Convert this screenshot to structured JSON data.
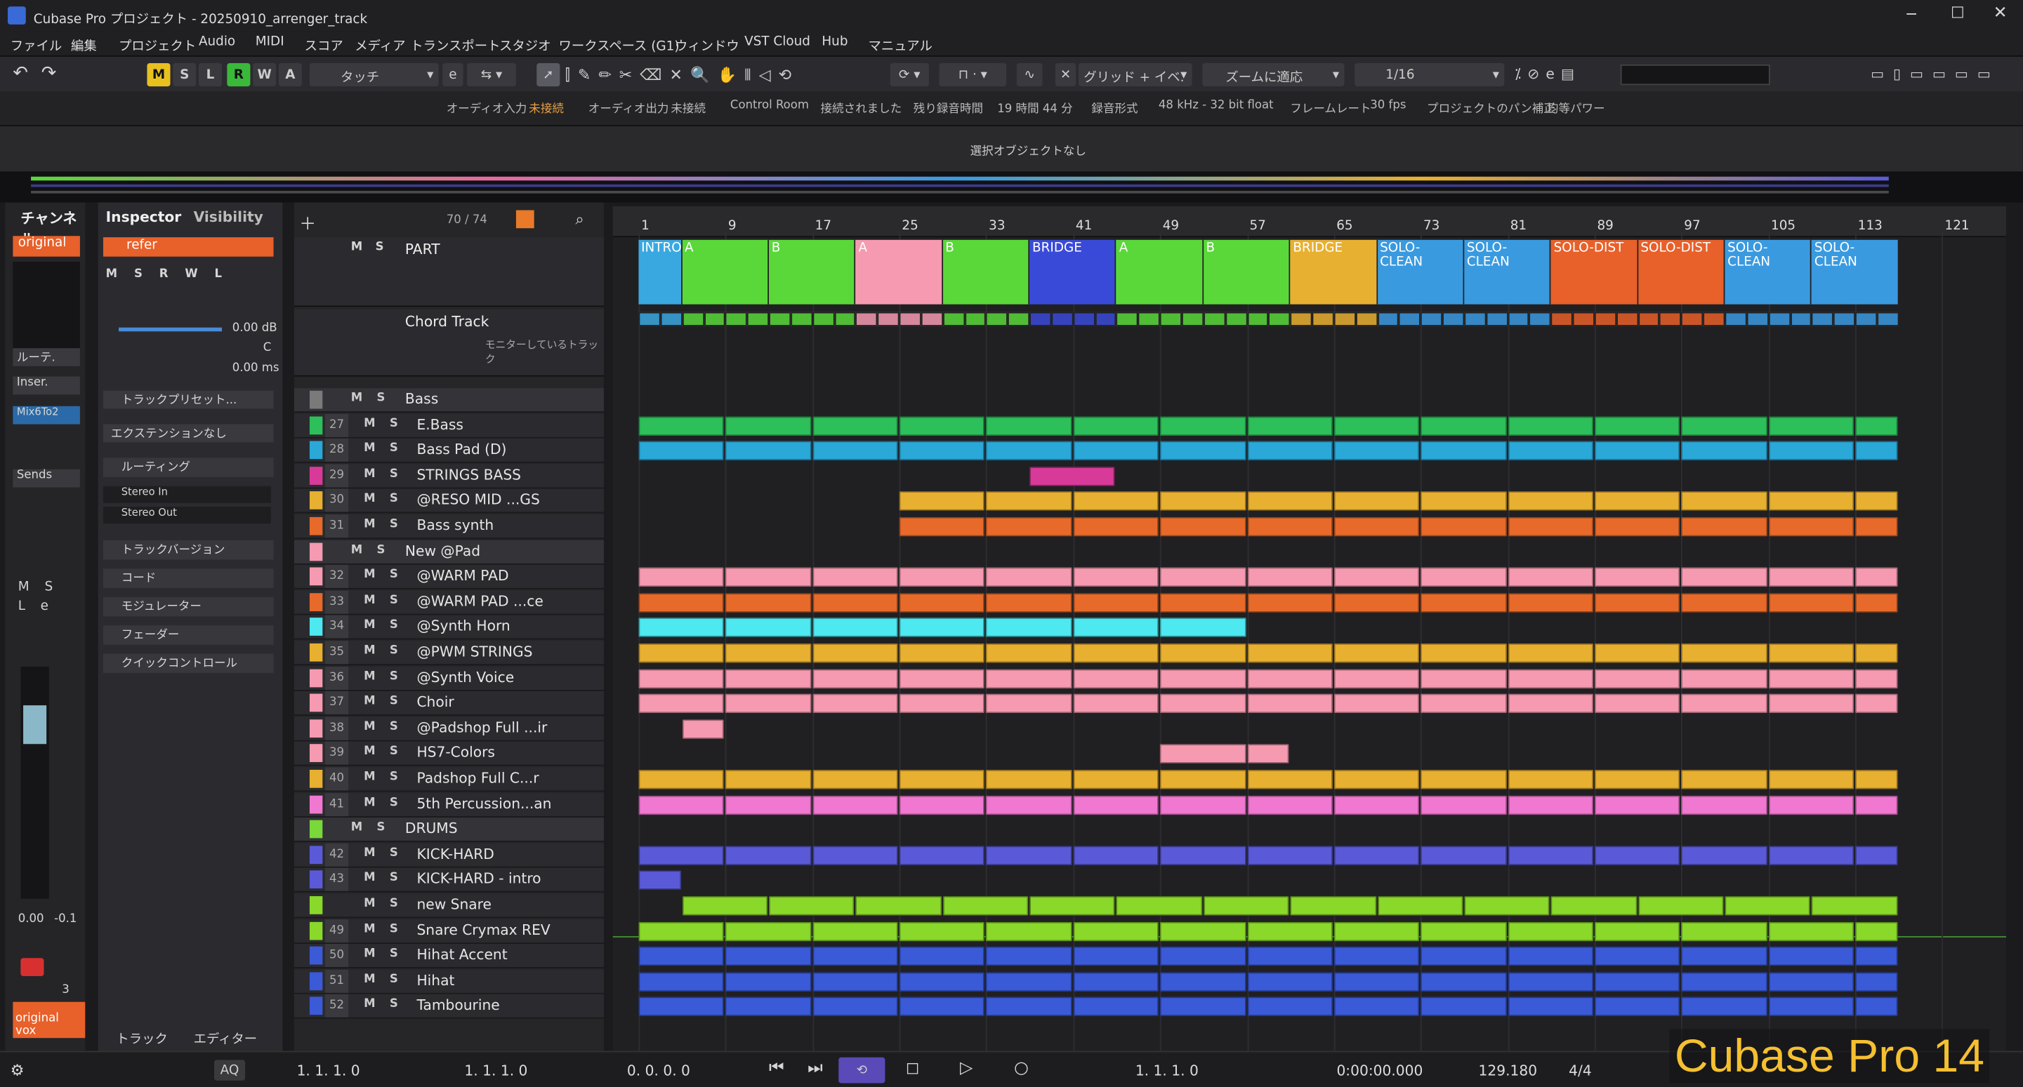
{
  "window": {
    "title": "Cubase Pro プロジェクト - 20250910_arrenger_track",
    "logo": "Cubase Pro 14"
  },
  "menu": [
    "ファイル",
    "編集",
    "プロジェクト",
    "Audio",
    "MIDI",
    "スコア",
    "メディア",
    "トランスポート",
    "スタジオ",
    "ワークスペース (G1)",
    "ウィンドウ",
    "VST Cloud",
    "Hub",
    "マニュアル"
  ],
  "toolbar": {
    "mode_letters": [
      "M",
      "S",
      "L",
      "R",
      "W",
      "A"
    ],
    "automation": "タッチ",
    "snap": "グリッド + イベ.",
    "zoom": "ズームに適応",
    "quantize": "1/16"
  },
  "status": {
    "audio_in_label": "オーディオ入力",
    "audio_in_val": "未接続",
    "audio_out_label": "オーディオ出力",
    "audio_out_val": "未接続",
    "cr_label": "Control Room",
    "cr_val": "接続されました",
    "rec_label": "残り録音時間",
    "rec_val": "19 時間 44 分",
    "fmt_label": "録音形式",
    "fmt_val": "48 kHz - 32 bit float",
    "fr_label": "フレームレート",
    "fr_val": "30 fps",
    "pan_label": "プロジェクトのパン補正",
    "pan_val": "均等パワー"
  },
  "info_line": "選択オブジェクトなし",
  "channel": {
    "tab": "チャンネル",
    "name": "original",
    "route": "ルーテ.",
    "insert": "Inser.",
    "plugin": "Mix6To2",
    "sends": "Sends",
    "vol1": "0.00",
    "vol2": "-0.1",
    "num": "3",
    "bottom": "original vox"
  },
  "inspector": {
    "tab1": "Inspector",
    "tab2": "Visibility",
    "track": "refer",
    "db": "0.00 dB",
    "pan": "C",
    "ms": "0.00 ms",
    "preset": "トラックプリセット...",
    "ext": "エクステンションなし",
    "routing": "ルーティング",
    "in": "Stereo In",
    "out": "Stereo Out",
    "sections": [
      "トラックバージョン",
      "コード",
      "モジュレーター",
      "フェーダー",
      "クイックコントロール"
    ],
    "bottom_tab1": "トラック",
    "bottom_tab2": "エディター"
  },
  "tracklist": {
    "count": "70 / 74",
    "part_name": "PART",
    "chord_name": "Chord Track",
    "chord_sub": "モニターしているトラック"
  },
  "tracks": [
    {
      "n": "",
      "name": "Bass",
      "type": "folder",
      "color": "#7a7a7a"
    },
    {
      "n": "27",
      "name": "E.Bass",
      "color": "#2dbf5a"
    },
    {
      "n": "28",
      "name": "Bass Pad (D)",
      "color": "#2aa8d8"
    },
    {
      "n": "29",
      "name": "STRINGS BASS",
      "color": "#d83a9a"
    },
    {
      "n": "30",
      "name": "@RESO MID ...GS",
      "color": "#e8b030"
    },
    {
      "n": "31",
      "name": "Bass synth",
      "color": "#e86a2a"
    },
    {
      "n": "",
      "name": "New @Pad",
      "type": "folder",
      "color": "#f59ab0"
    },
    {
      "n": "32",
      "name": "@WARM PAD",
      "color": "#f59ab0"
    },
    {
      "n": "33",
      "name": "@WARM PAD ...ce",
      "color": "#e86a2a"
    },
    {
      "n": "34",
      "name": "@Synth Horn",
      "color": "#4ee8f0"
    },
    {
      "n": "35",
      "name": "@PWM STRINGS",
      "color": "#e8b030"
    },
    {
      "n": "36",
      "name": "@Synth Voice",
      "color": "#f59ab0"
    },
    {
      "n": "37",
      "name": "Choir",
      "color": "#f59ab0"
    },
    {
      "n": "38",
      "name": "@Padshop Full ...ir",
      "color": "#f59ab0"
    },
    {
      "n": "39",
      "name": "HS7-Colors",
      "color": "#f59ab0"
    },
    {
      "n": "40",
      "name": "Padshop Full C...r",
      "color": "#e8b030"
    },
    {
      "n": "41",
      "name": "5th Percussion...an",
      "color": "#f078d0"
    },
    {
      "n": "",
      "name": "DRUMS",
      "type": "folder",
      "color": "#7ad83a"
    },
    {
      "n": "42",
      "name": "KICK-HARD",
      "color": "#5a5ad8"
    },
    {
      "n": "43",
      "name": "KICK-HARD - intro",
      "color": "#5a5ad8"
    },
    {
      "n": "",
      "name": "new Snare",
      "color": "#8ad82a"
    },
    {
      "n": "49",
      "name": "Snare Crymax REV",
      "color": "#8ad82a"
    },
    {
      "n": "50",
      "name": "Hihat Accent",
      "color": "#3a5ad8"
    },
    {
      "n": "51",
      "name": "Hihat",
      "color": "#3a5ad8"
    },
    {
      "n": "52",
      "name": "Tambourine",
      "color": "#3a5ad8"
    }
  ],
  "ruler": [
    "1",
    "9",
    "17",
    "25",
    "33",
    "41",
    "49",
    "57",
    "65",
    "73",
    "81",
    "89",
    "97",
    "105",
    "113",
    "121"
  ],
  "parts": [
    {
      "label": "INTRO",
      "bar": 1,
      "len": 4,
      "color": "#3aa8e0"
    },
    {
      "label": "A",
      "bar": 5,
      "len": 8,
      "color": "#5ad83a"
    },
    {
      "label": "B",
      "bar": 13,
      "len": 8,
      "color": "#5ad83a"
    },
    {
      "label": "A",
      "bar": 21,
      "len": 8,
      "color": "#f59ab0"
    },
    {
      "label": "B",
      "bar": 29,
      "len": 8,
      "color": "#5ad83a"
    },
    {
      "label": "BRIDGE",
      "bar": 37,
      "len": 8,
      "color": "#3a4ad8"
    },
    {
      "label": "A",
      "bar": 45,
      "len": 8,
      "color": "#5ad83a"
    },
    {
      "label": "B",
      "bar": 53,
      "len": 8,
      "color": "#5ad83a"
    },
    {
      "label": "BRIDGE",
      "bar": 61,
      "len": 8,
      "color": "#e8b030"
    },
    {
      "label": "SOLO-CLEAN",
      "bar": 69,
      "len": 8,
      "color": "#3a9ae0"
    },
    {
      "label": "SOLO-CLEAN",
      "bar": 77,
      "len": 8,
      "color": "#3a9ae0"
    },
    {
      "label": "SOLO-DIST",
      "bar": 85,
      "len": 8,
      "color": "#e8602a"
    },
    {
      "label": "SOLO-DIST",
      "bar": 93,
      "len": 8,
      "color": "#e8602a"
    },
    {
      "label": "SOLO-CLEAN",
      "bar": 101,
      "len": 8,
      "color": "#3a9ae0"
    },
    {
      "label": "SOLO-CLEAN",
      "bar": 109,
      "len": 8,
      "color": "#3a9ae0"
    }
  ],
  "transport": {
    "pos1": "1. 1. 1.  0",
    "pos2": "1. 1. 1.  0",
    "pos3": "0. 0. 0.  0",
    "pos4": "1. 1. 1.  0",
    "time": "0:00:00.000",
    "tempo": "129.180",
    "sig": "4/4",
    "aq": "AQ"
  }
}
